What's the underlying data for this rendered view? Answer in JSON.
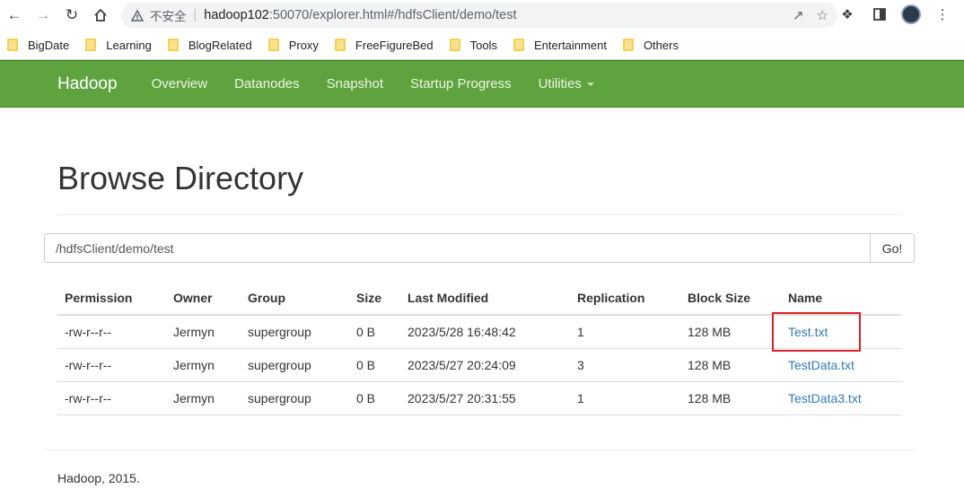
{
  "browser": {
    "insecure_label": "不安全",
    "url_host": "hadoop102",
    "url_path": ":50070/explorer.html#/hdfsClient/demo/test",
    "bookmarks": [
      "BigDate",
      "Learning",
      "BlogRelated",
      "Proxy",
      "FreeFigureBed",
      "Tools",
      "Entertainment",
      "Others"
    ]
  },
  "navbar": {
    "brand": "Hadoop",
    "links": [
      "Overview",
      "Datanodes",
      "Snapshot",
      "Startup Progress",
      "Utilities"
    ],
    "accent": "#5fa33e"
  },
  "page": {
    "title": "Browse Directory",
    "path_value": "/hdfsClient/demo/test",
    "go_label": "Go!"
  },
  "table": {
    "headers": [
      "Permission",
      "Owner",
      "Group",
      "Size",
      "Last Modified",
      "Replication",
      "Block Size",
      "Name"
    ],
    "rows": [
      [
        "-rw-r--r--",
        "Jermyn",
        "supergroup",
        "0 B",
        "2023/5/28 16:48:42",
        "1",
        "128 MB",
        "Test.txt"
      ],
      [
        "-rw-r--r--",
        "Jermyn",
        "supergroup",
        "0 B",
        "2023/5/27 20:24:09",
        "3",
        "128 MB",
        "TestData.txt"
      ],
      [
        "-rw-r--r--",
        "Jermyn",
        "supergroup",
        "0 B",
        "2023/5/27 20:31:55",
        "1",
        "128 MB",
        "TestData3.txt"
      ]
    ]
  },
  "footer": {
    "text": "Hadoop, 2015."
  }
}
